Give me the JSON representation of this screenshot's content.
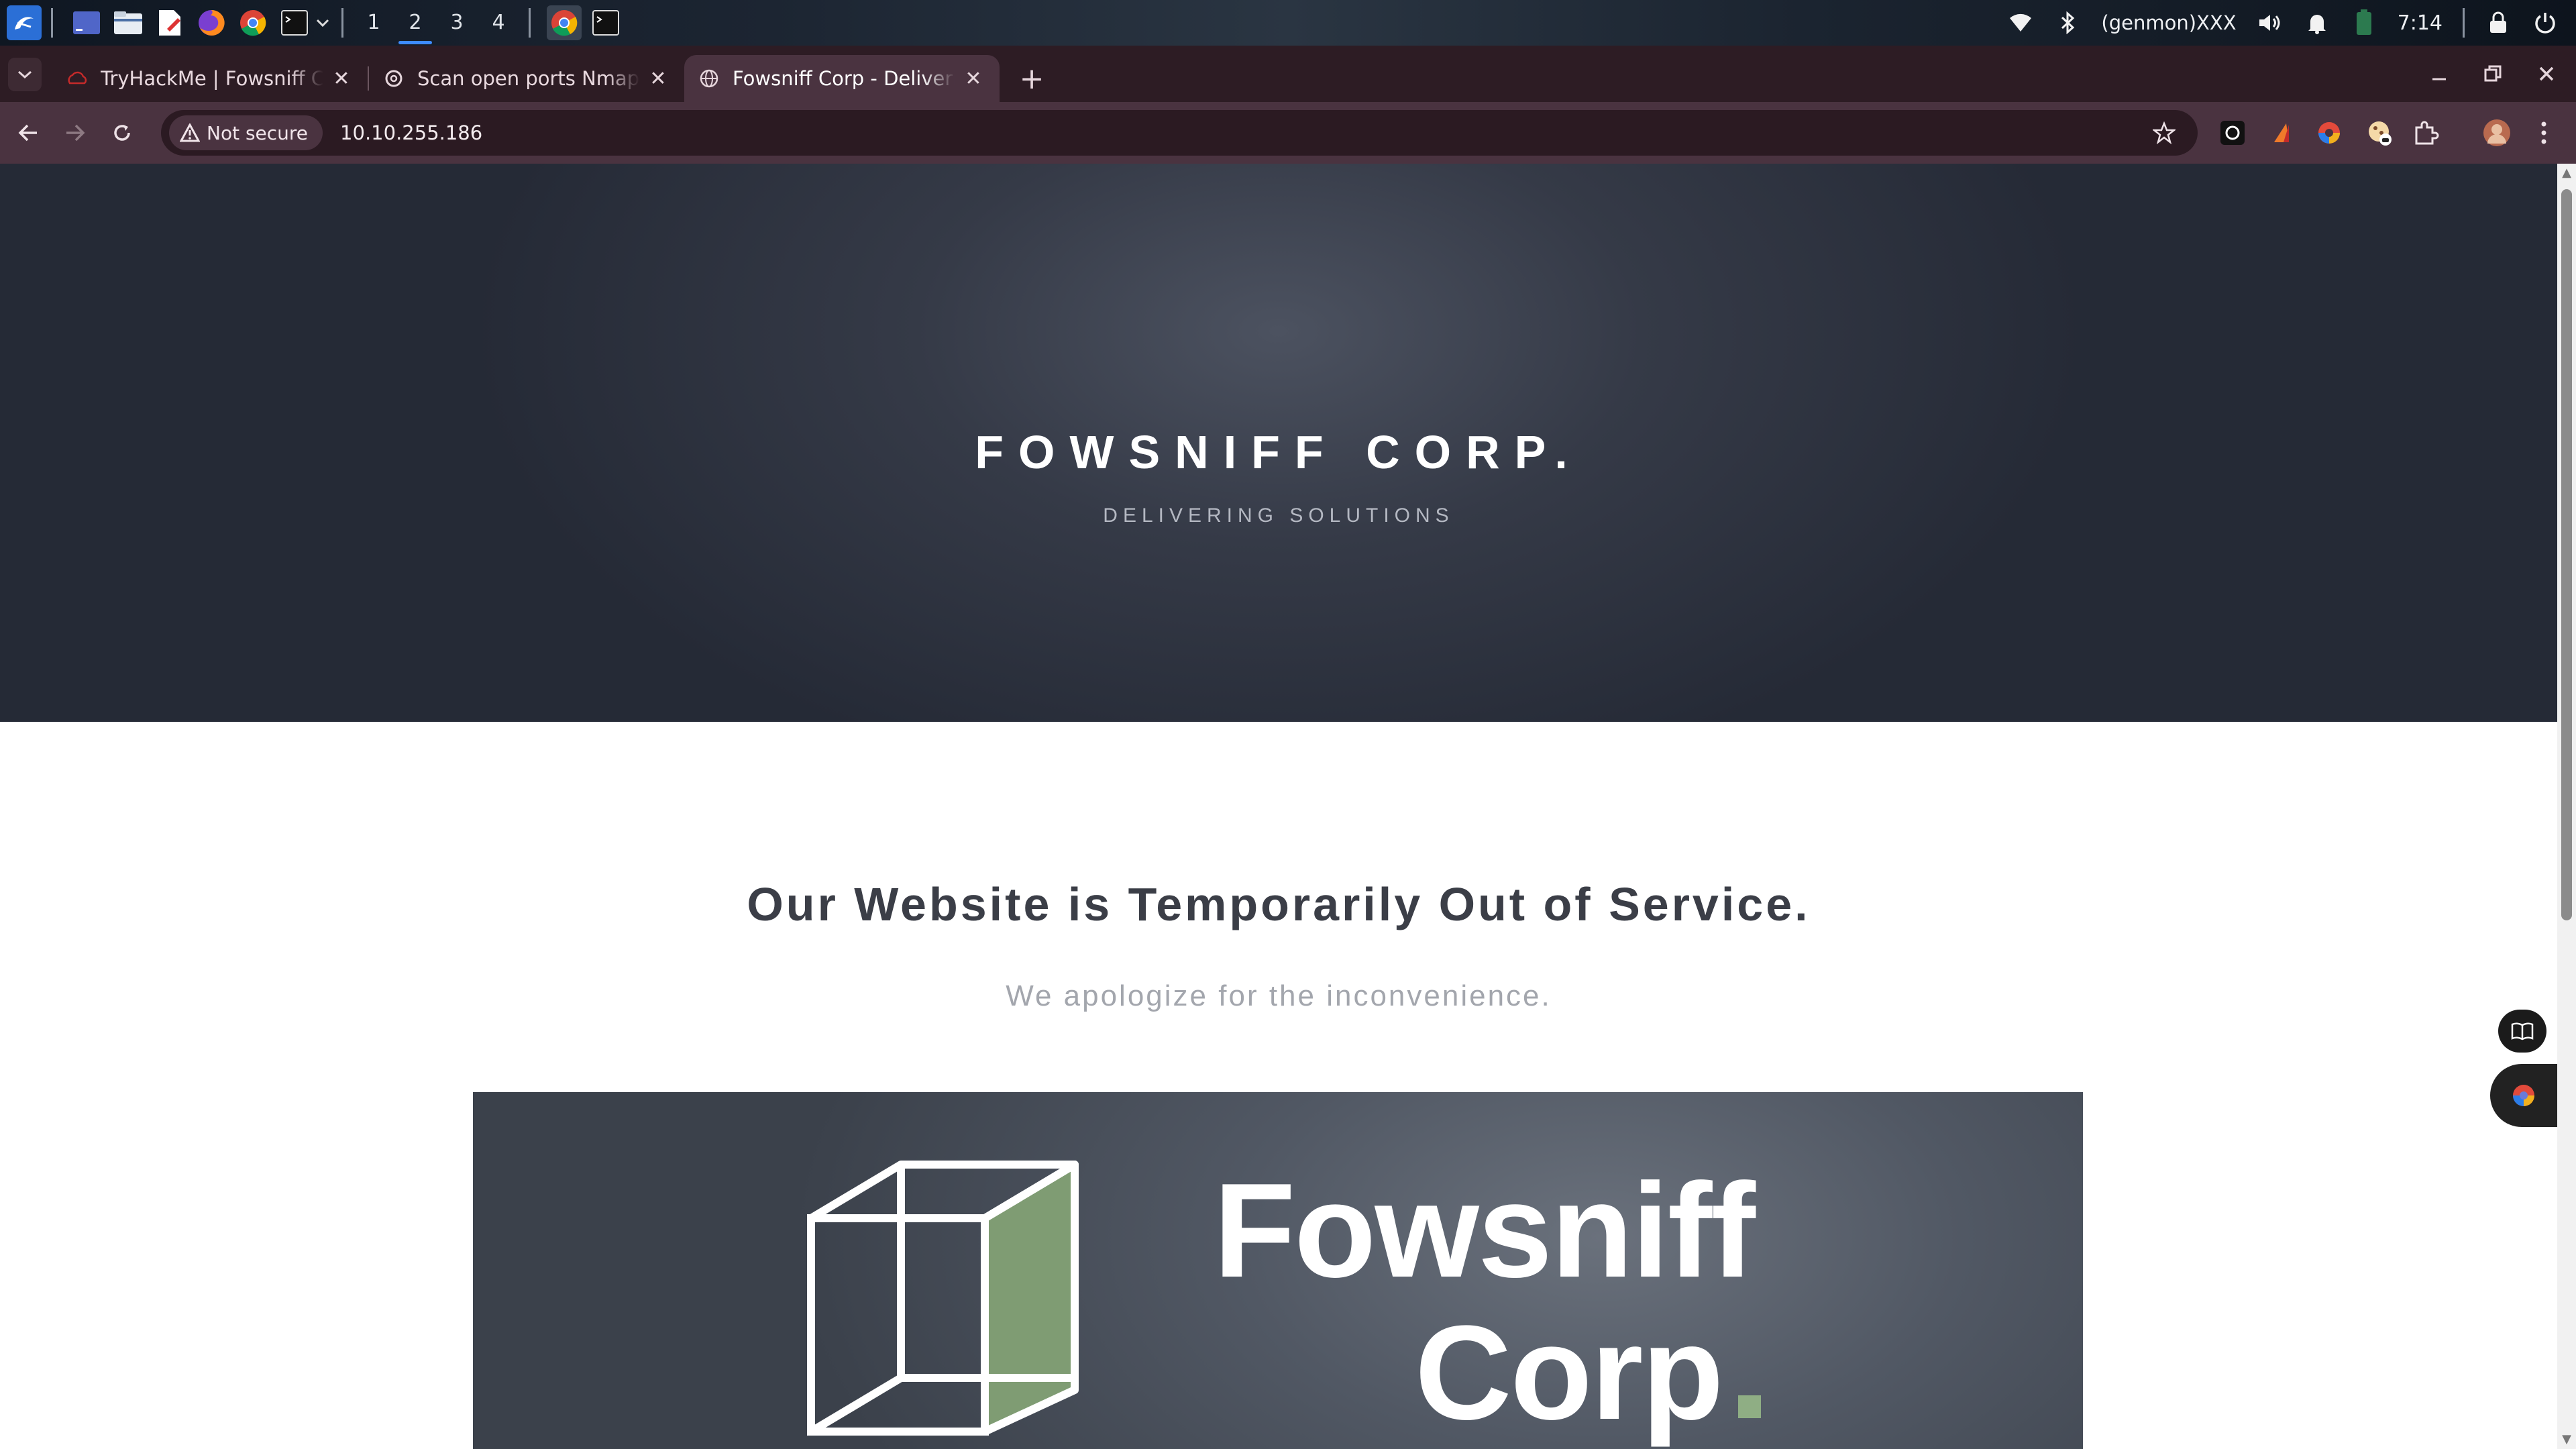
{
  "os_panel": {
    "workspaces": [
      "1",
      "2",
      "3",
      "4"
    ],
    "active_workspace": "2",
    "genmon_label": "(genmon)XXX",
    "clock": "7:14",
    "icons": [
      "kali-menu-icon",
      "terminal-app-icon",
      "file-manager-icon",
      "text-editor-icon",
      "firefox-icon",
      "chrome-icon",
      "terminal-icon"
    ]
  },
  "browser": {
    "tabs": [
      {
        "title": "TryHackMe | Fowsniff CTF",
        "icon": "tryhackme-favicon",
        "active": false
      },
      {
        "title": "Scan open ports Nmap",
        "icon": "openai-favicon",
        "active": false
      },
      {
        "title": "Fowsniff Corp - Delivering Solutions",
        "icon": "globe-icon",
        "active": true
      }
    ],
    "security_chip": "Not secure",
    "url": "10.10.255.186",
    "accent": "#4a3340"
  },
  "page": {
    "hero_title": "FOWSNIFF CORP.",
    "hero_subtitle": "DELIVERING SOLUTIONS",
    "heading": "Our Website is Temporarily Out of Service.",
    "subheading": "We apologize for the inconvenience.",
    "banner": {
      "word1": "Fowsniff",
      "word2": "Corp",
      "accent_color": "#8fae84"
    }
  }
}
